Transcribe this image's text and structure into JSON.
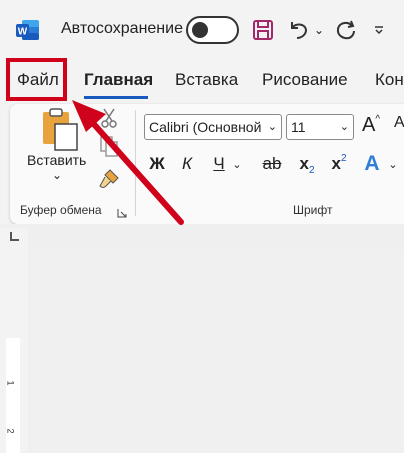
{
  "titlebar": {
    "app_logo_letter": "W",
    "autosave_label": "Автосохранение",
    "brand_color": "#185abd"
  },
  "tabs": [
    {
      "label": "Файл",
      "active": false
    },
    {
      "label": "Главная",
      "active": true
    },
    {
      "label": "Вставка",
      "active": false
    },
    {
      "label": "Рисование",
      "active": false
    },
    {
      "label": "Кон",
      "active": false
    }
  ],
  "ribbon": {
    "clipboard": {
      "paste_label": "Вставить",
      "paste_chevron": "⌄",
      "group_label": "Буфер обмена"
    },
    "font": {
      "font_name": "Calibri (Основной",
      "font_size": "11",
      "bold": "Ж",
      "italic": "К",
      "underline": "Ч",
      "strikethrough": "ab",
      "subscript_base": "x",
      "subscript_mark": "2",
      "superscript_base": "x",
      "superscript_mark": "2",
      "text_effects": "A",
      "group_label": "Шрифт"
    }
  },
  "ruler": {
    "numbers": [
      "1",
      "2"
    ]
  },
  "annotation": {
    "highlight_color": "#d0021b"
  }
}
